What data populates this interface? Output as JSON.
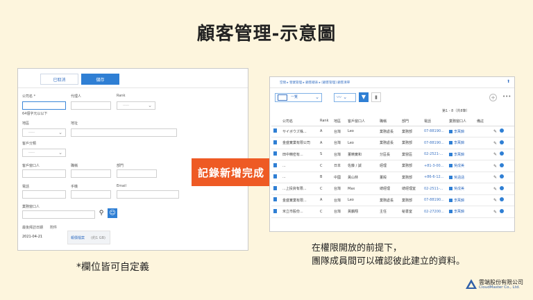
{
  "title": "顧客管理-示意圖",
  "form": {
    "cancel_label": "已取消",
    "save_label": "儲存",
    "company_label": "公司名 *",
    "company_hint": "64個字元以以下",
    "agent_label": "代理人",
    "rank_label": "Rank",
    "rank_placeholder": "-----",
    "region_label": "地區",
    "region_placeholder": "-----",
    "address_label": "地址",
    "category_label": "客戶分類",
    "category_placeholder": "-----",
    "contact_label": "客戶窗口人",
    "title_label": "職稱",
    "dept_label": "部門",
    "phone_label": "電話",
    "mobile_label": "手機",
    "email_label": "Email",
    "owner_label": "業務窗口人",
    "last_visit_label": "最後拜訪日期",
    "attachment_label": "附件",
    "date_value": "2021-04-21",
    "attachment_link": "報價檔案",
    "attachment_size": "(約1 GB)"
  },
  "arrow_label": "記錄新增完成",
  "list": {
    "breadcrumb": "空間 ▸ 營業管理 ▸ 顧客總表 ▸ [顧客管理] 顧客清單",
    "view_label": "一覽",
    "count_label": "第1 - 8（共8筆）",
    "columns": [
      "公司名",
      "Rank",
      "地區",
      "客戶窗口人",
      "職稱",
      "部門",
      "電話",
      "業務窗口人",
      "備註"
    ],
    "rows": [
      [
        "サイボウズ株...",
        "A",
        "台灣",
        "Leo",
        "業務處長",
        "業務部",
        "07-88190...",
        "李萬錦"
      ],
      [
        "金盛實業有限公司",
        "A",
        "台灣",
        "Leo",
        "業務處長",
        "業務部",
        "07-88190...",
        "李萬錦"
      ],
      [
        "田中精密有...",
        "S",
        "台灣",
        "董精實和",
        "分區長",
        "業營區",
        "02-2521-...",
        "李萬錦"
      ],
      [
        "...",
        "C",
        "日本",
        "佐藤 / 誠",
        "經理",
        "業務部",
        "+81-3-00...",
        "吳成美"
      ],
      [
        "...",
        "B",
        "中國",
        "黃山林",
        "董殿",
        "業務部",
        "+86-6-12...",
        "吳涵涵"
      ],
      [
        "...上投資有限...",
        "C",
        "台灣",
        "Max",
        "總經理",
        "總經理室",
        "02-2511-...",
        "吳成美"
      ],
      [
        "金盛實業有限...",
        "A",
        "台灣",
        "Leo",
        "業務處長",
        "業務部",
        "07-88190...",
        "李萬錦"
      ],
      [
        "米立市股份...",
        "C",
        "台灣",
        "黃鵬翔",
        "主任",
        "秘書室",
        "02-27200...",
        "李萬錦"
      ]
    ]
  },
  "caption_left": "*欄位皆可自定義",
  "caption_right_1": "在權限開放的前提下，",
  "caption_right_2": "團隊成員間可以確認彼此建立的資料。",
  "logo": {
    "name": "雲端股份有限公司",
    "en": "CloudMaster Co., Ltd."
  },
  "colors": {
    "accent": "#2f7fd4",
    "arrow": "#ee5a24",
    "background": "#fdf5dd"
  }
}
